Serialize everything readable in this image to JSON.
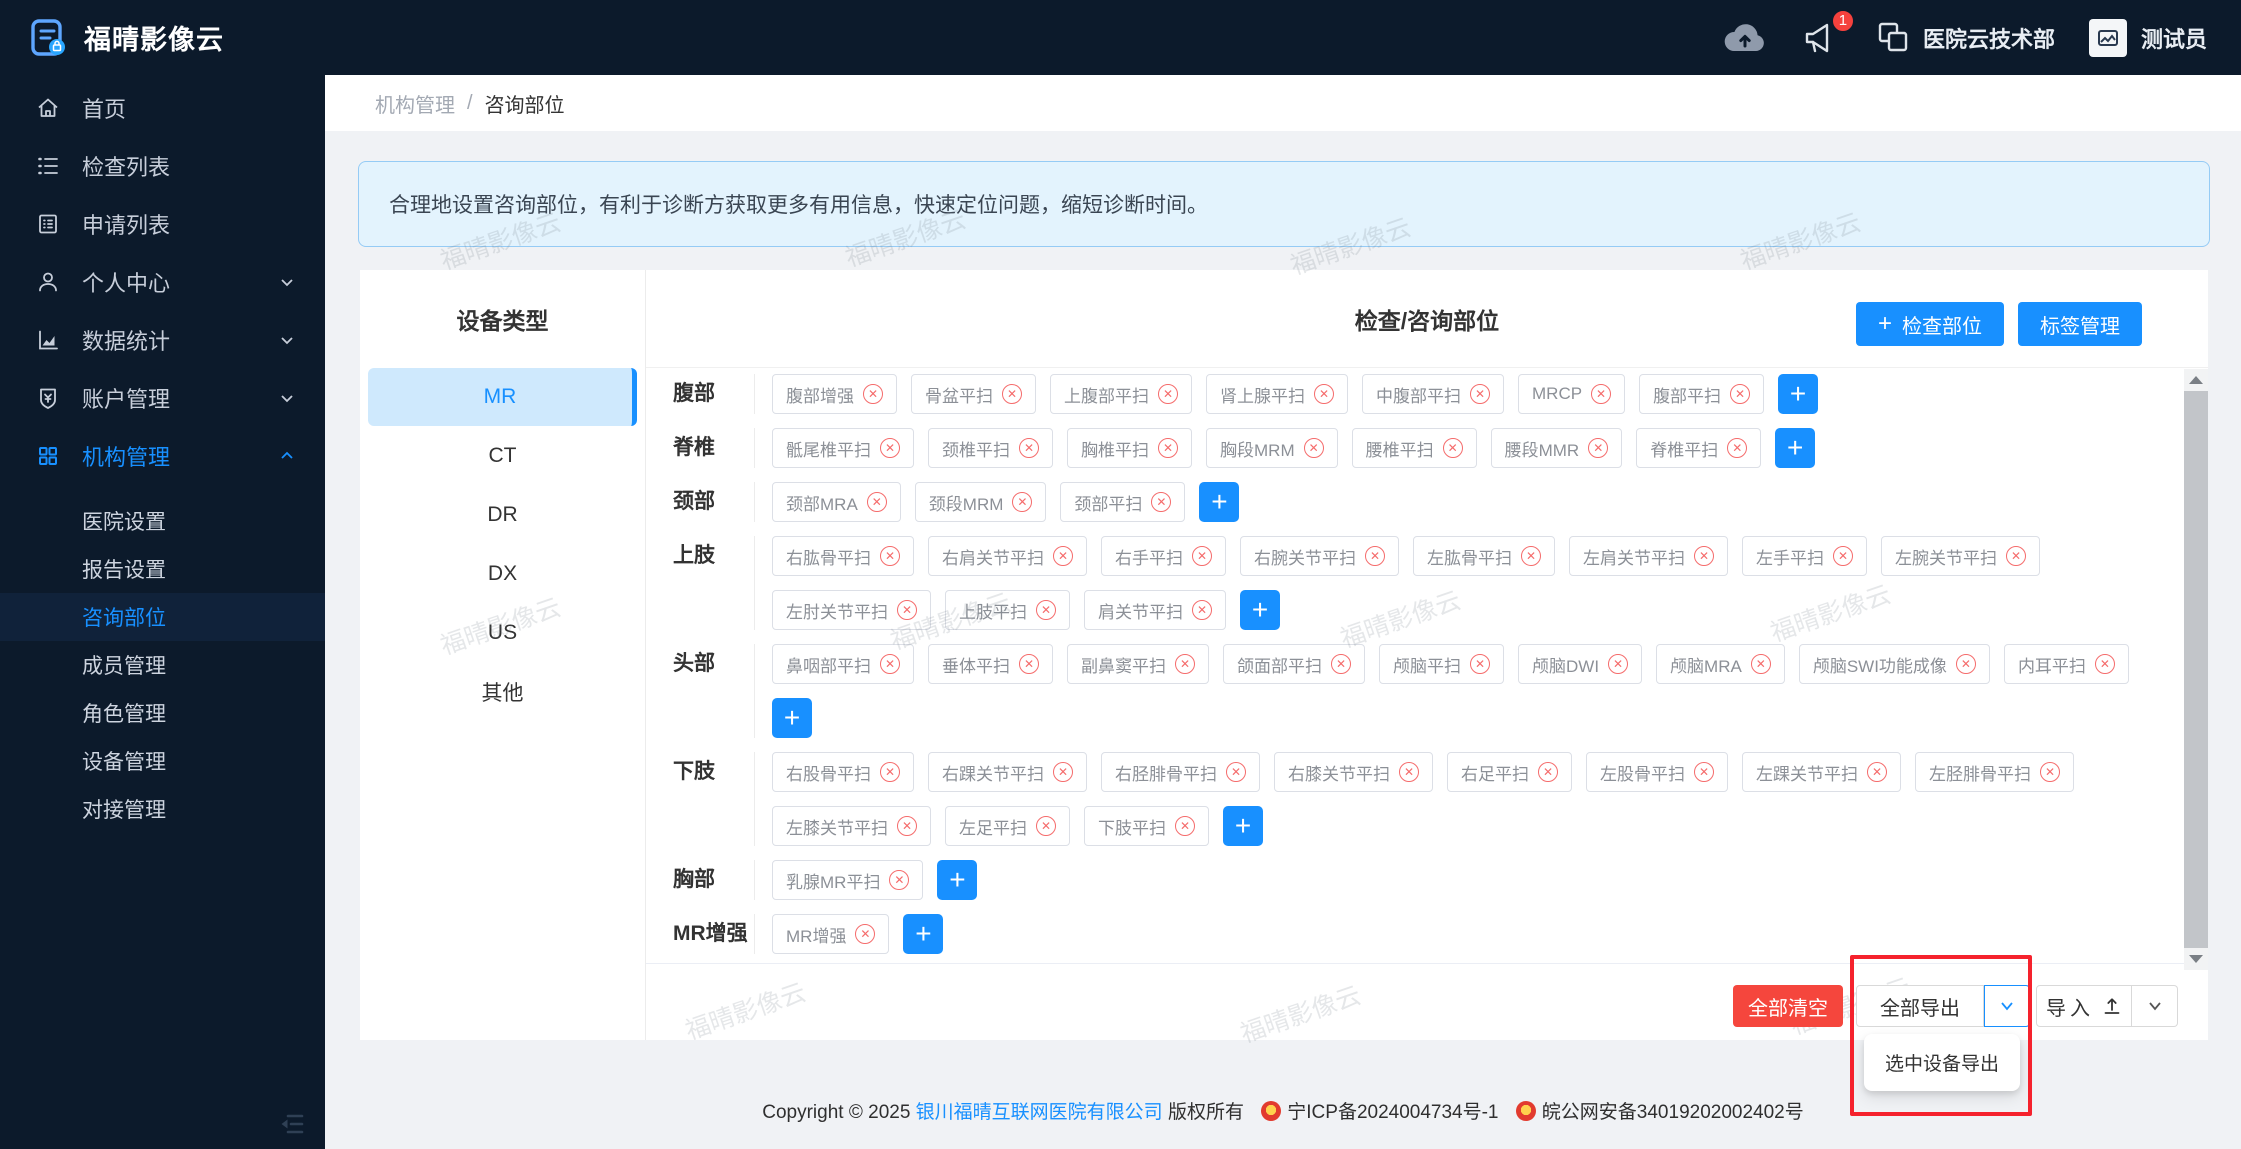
{
  "header": {
    "logo_text": "福晴影像云",
    "notification_badge": "1",
    "org_name": "医院云技术部",
    "user_name": "测试员"
  },
  "sidebar": {
    "items": [
      {
        "label": "首页",
        "icon": "home-icon"
      },
      {
        "label": "检查列表",
        "icon": "exam-list-icon"
      },
      {
        "label": "申请列表",
        "icon": "request-list-icon"
      },
      {
        "label": "个人中心",
        "icon": "user-icon",
        "chevron": "down"
      },
      {
        "label": "数据统计",
        "icon": "stats-icon",
        "chevron": "down"
      },
      {
        "label": "账户管理",
        "icon": "account-icon",
        "chevron": "down"
      },
      {
        "label": "机构管理",
        "icon": "org-icon",
        "chevron": "up",
        "active": true
      }
    ],
    "subitems": [
      {
        "label": "医院设置"
      },
      {
        "label": "报告设置"
      },
      {
        "label": "咨询部位",
        "active": true
      },
      {
        "label": "成员管理"
      },
      {
        "label": "角色管理"
      },
      {
        "label": "设备管理"
      },
      {
        "label": "对接管理"
      }
    ]
  },
  "breadcrumb": {
    "parent": "机构管理",
    "separator": "/",
    "current": "咨询部位"
  },
  "banner": {
    "text": "合理地设置咨询部位，有利于诊断方获取更多有用信息，快速定位问题，缩短诊断时间。"
  },
  "device_panel": {
    "title": "设备类型",
    "items": [
      {
        "label": "MR",
        "active": true
      },
      {
        "label": "CT"
      },
      {
        "label": "DR"
      },
      {
        "label": "DX"
      },
      {
        "label": "US"
      },
      {
        "label": "其他"
      }
    ]
  },
  "main": {
    "title": "检查/咨询部位",
    "add_part_button": "检查部位",
    "tag_manage_button": "标签管理",
    "rows": [
      {
        "label": "腹部",
        "tags": [
          "腹部增强",
          "骨盆平扫",
          "上腹部平扫",
          "肾上腺平扫",
          "中腹部平扫",
          "MRCP",
          "腹部平扫"
        ]
      },
      {
        "label": "脊椎",
        "tags": [
          "骶尾椎平扫",
          "颈椎平扫",
          "胸椎平扫",
          "胸段MRM",
          "腰椎平扫",
          "腰段MMR",
          "脊椎平扫"
        ]
      },
      {
        "label": "颈部",
        "tags": [
          "颈部MRA",
          "颈段MRM",
          "颈部平扫"
        ]
      },
      {
        "label": "上肢",
        "tags": [
          "右肱骨平扫",
          "右肩关节平扫",
          "右手平扫",
          "右腕关节平扫",
          "左肱骨平扫",
          "左肩关节平扫",
          "左手平扫",
          "左腕关节平扫",
          "左肘关节平扫",
          "上肢平扫",
          "肩关节平扫"
        ]
      },
      {
        "label": "头部",
        "tags": [
          "鼻咽部平扫",
          "垂体平扫",
          "副鼻窦平扫",
          "颌面部平扫",
          "颅脑平扫",
          "颅脑DWI",
          "颅脑MRA",
          "颅脑SWI功能成像",
          "内耳平扫"
        ]
      },
      {
        "label": "下肢",
        "tags": [
          "右股骨平扫",
          "右踝关节平扫",
          "右胫腓骨平扫",
          "右膝关节平扫",
          "右足平扫",
          "左股骨平扫",
          "左踝关节平扫",
          "左胫腓骨平扫",
          "左膝关节平扫",
          "左足平扫",
          "下肢平扫"
        ]
      },
      {
        "label": "胸部",
        "tags": [
          "乳腺MR平扫"
        ]
      },
      {
        "label": "MR增强",
        "tags": [
          "MR增强"
        ]
      }
    ]
  },
  "actions": {
    "clear_all": "全部清空",
    "export_all": "全部导出",
    "import_label": "导入",
    "dropdown_item": "选中设备导出"
  },
  "footer": {
    "copyright": "Copyright © 2025",
    "company": "银川福晴互联网医院有限公司",
    "rights": "版权所有",
    "icp": "宁ICP备2024004734号-1",
    "police": "皖公网安备34019202002402号"
  },
  "watermark": {
    "text": "福晴影像云"
  },
  "colors": {
    "primary": "#1890ff",
    "danger": "#f5463d",
    "annotation": "#f5222d",
    "header_bg": "#0c1a2b"
  }
}
